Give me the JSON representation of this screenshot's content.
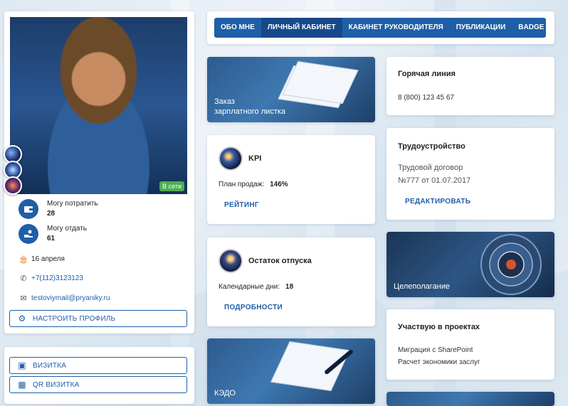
{
  "profile": {
    "online_label": "В сети",
    "can_spend_label": "Могу потратить",
    "can_spend_value": "28",
    "can_give_label": "Могу отдать",
    "can_give_value": "61",
    "birthday": "16 апреля",
    "phone": "+7(112)3123123",
    "email": "testoviymail@pryaniky.ru",
    "configure_button": "НАСТРОИТЬ ПРОФИЛЬ"
  },
  "cards": {
    "vizitka_button": "ВИЗИТКА",
    "qr_button": "QR ВИЗИТКА"
  },
  "tabs": [
    "ОБО МНЕ",
    "ЛИЧНЫЙ КАБИНЕТ",
    "КАБИНЕТ РУКОВОДИТЕЛЯ",
    "ПУБЛИКАЦИИ",
    "BADGE"
  ],
  "tiles": {
    "payslip_line1": "Заказ",
    "payslip_line2": "зарплатного листка",
    "goals": "Целеполагание",
    "edo": "КЭДО"
  },
  "kpi": {
    "title": "KPI",
    "plan_label": "План продаж:",
    "plan_value": "146%",
    "rating_button": "РЕЙТИНГ"
  },
  "vacation": {
    "title": "Остаток отпуска",
    "days_label": "Календарные дни:",
    "days_value": "18",
    "details_button": "ПОДРОБНОСТИ"
  },
  "hotline": {
    "title": "Горячая линия",
    "phone": "8 (800) 123 45 67"
  },
  "employment": {
    "title": "Трудоустройство",
    "type": "Трудовой договор",
    "contract": "№777 от 01.07.2017",
    "edit_button": "РЕДАКТИРОВАТЬ"
  },
  "projects": {
    "title": "Участвую в проектах",
    "items": [
      "Миграция с SharePoint",
      "Расчет экономики заслуг"
    ]
  },
  "colors": {
    "accent": "#1f5fa8",
    "online": "#4caf50"
  }
}
